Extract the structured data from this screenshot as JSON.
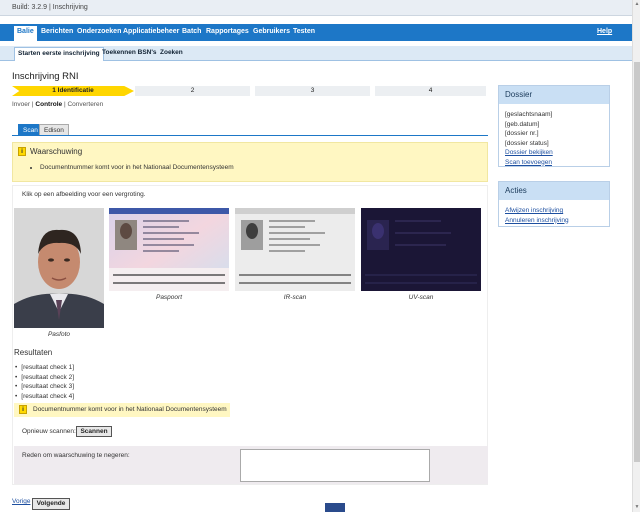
{
  "top": {
    "build": "Build: 3.2.9",
    "separator": "|",
    "context": "Inschrijving"
  },
  "nav": {
    "tabs": [
      "Balie",
      "Berichten",
      "Onderzoeken",
      "Applicatiebeheer",
      "Batch",
      "Rapportages",
      "Gebruikers",
      "Testen"
    ],
    "help": "Help"
  },
  "subnav": [
    "Starten eerste inschrijving",
    "Toekennen BSN's",
    "Zoeken"
  ],
  "page": {
    "title": "Inschrijving RNI"
  },
  "steps": [
    "1 Identificatie",
    "2",
    "3",
    "4"
  ],
  "substeps": {
    "a": "Invoer",
    "sep1": "|",
    "b": "Controle",
    "sep2": "|",
    "c": "Converteren"
  },
  "scantabs": [
    "Scan",
    "Edison"
  ],
  "warning": {
    "icon": "i",
    "title": "Waarschuwing",
    "items": [
      "Documentnummer komt voor in het Nationaal Documentensysteem"
    ]
  },
  "images": {
    "hint": "Klik op een afbeelding voor een vergroting.",
    "captions": [
      "Pasfoto",
      "Paspoort",
      "IR-scan",
      "UV-scan"
    ]
  },
  "results": {
    "title": "Resultaten",
    "items": [
      "[resultaat check 1]",
      "[resultaat check 2]",
      "[resultaat check 3]",
      "[resultaat check 4]"
    ]
  },
  "warning2": "Documentnummer komt voor in het Nationaal Documentensysteem",
  "rescan": {
    "label": "Opnieuw scannen:",
    "button": "Scannen"
  },
  "reason": {
    "label": "Reden om waarschuwing te negeren:",
    "value": ""
  },
  "footer": {
    "prev": "Vorige",
    "next": "Volgende"
  },
  "dossier": {
    "title": "Dossier",
    "fields": [
      "[geslachtsnaam]",
      "[geb.datum]",
      "[dossier nr.]",
      "[dossier status]"
    ],
    "links": [
      "Dossier bekijken",
      "Scan toevoegen"
    ]
  },
  "acties": {
    "title": "Acties",
    "links": [
      "Afwijzen inschrijving",
      "Annuleren inschrijving"
    ]
  },
  "colors": {
    "primary": "#1d77c7",
    "step_active": "#ffd600",
    "warning_bg": "#fff7c2"
  }
}
